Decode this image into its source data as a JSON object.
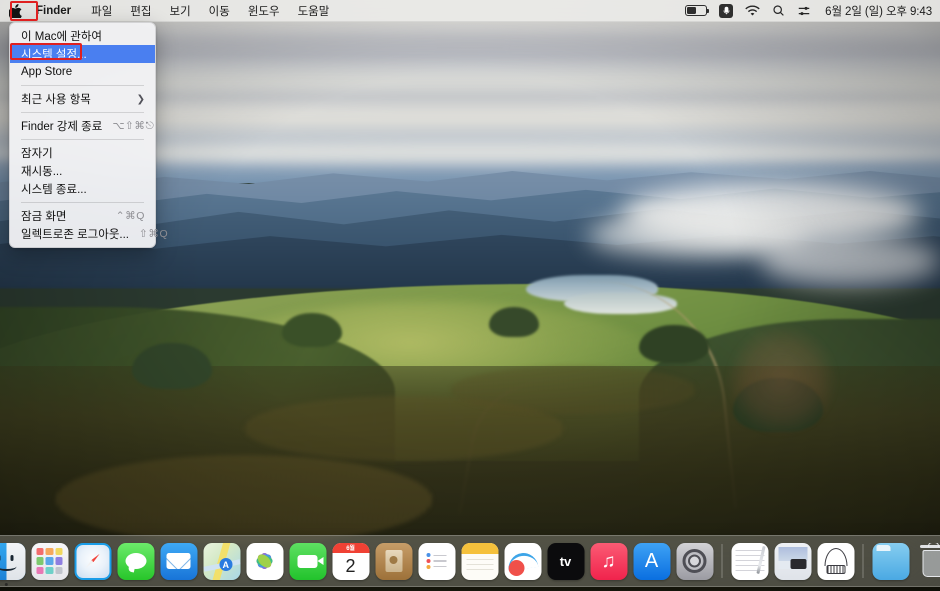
{
  "menubar": {
    "apple_icon": "apple-logo-icon",
    "app_name": "Finder",
    "items": [
      {
        "label": "파일"
      },
      {
        "label": "편집"
      },
      {
        "label": "보기"
      },
      {
        "label": "이동"
      },
      {
        "label": "윈도우"
      },
      {
        "label": "도움말"
      }
    ],
    "status_icons": [
      {
        "name": "battery-icon"
      },
      {
        "name": "screen-recording-icon"
      },
      {
        "name": "wifi-icon"
      },
      {
        "name": "spotlight-search-icon"
      },
      {
        "name": "control-center-icon"
      }
    ],
    "clock": "6월 2일 (일) 오후 9:43"
  },
  "apple_menu": {
    "selected_index": 1,
    "highlight_color": "#4a7ff0",
    "annotation_color": "#e02020",
    "items": [
      {
        "label": "이 Mac에 관하여",
        "shortcut": "",
        "arrow": ""
      },
      {
        "label": "시스템 설정...",
        "shortcut": "",
        "arrow": ""
      },
      {
        "label": "App Store",
        "shortcut": "",
        "arrow": ""
      },
      {
        "label": "최근 사용 항목",
        "shortcut": "",
        "arrow": "❯"
      },
      {
        "label": "Finder 강제 종료",
        "shortcut": "⌥⇧⌘⎋",
        "arrow": ""
      },
      {
        "label": "잠자기",
        "shortcut": "",
        "arrow": ""
      },
      {
        "label": "재시동...",
        "shortcut": "",
        "arrow": ""
      },
      {
        "label": "시스템 종료...",
        "shortcut": "",
        "arrow": ""
      },
      {
        "label": "잠금 화면",
        "shortcut": "⌃⌘Q",
        "arrow": ""
      },
      {
        "label": "일렉트로존 로그아웃...",
        "shortcut": "⇧⌘Q",
        "arrow": ""
      }
    ]
  },
  "dock": {
    "items": [
      {
        "name": "finder",
        "label": "Finder",
        "running": true
      },
      {
        "name": "launchpad",
        "label": "Launchpad",
        "running": false
      },
      {
        "name": "safari",
        "label": "Safari",
        "running": false
      },
      {
        "name": "messages",
        "label": "메시지",
        "running": false
      },
      {
        "name": "mail",
        "label": "Mail",
        "running": false
      },
      {
        "name": "maps",
        "label": "지도",
        "running": false
      },
      {
        "name": "photos",
        "label": "사진",
        "running": false
      },
      {
        "name": "facetime",
        "label": "FaceTime",
        "running": false
      },
      {
        "name": "calendar",
        "label": "캘린더",
        "running": false,
        "month": "6월",
        "day": "2"
      },
      {
        "name": "contacts",
        "label": "연락처",
        "running": false
      },
      {
        "name": "reminders",
        "label": "미리 알림",
        "running": false
      },
      {
        "name": "notes",
        "label": "메모",
        "running": false
      },
      {
        "name": "freeform",
        "label": "Freeform",
        "running": false
      },
      {
        "name": "apple-tv",
        "label": "Apple TV",
        "running": false,
        "glyph": "tv"
      },
      {
        "name": "music",
        "label": "음악",
        "running": false,
        "glyph": "♫"
      },
      {
        "name": "app-store",
        "label": "App Store",
        "running": false,
        "glyph": "A"
      },
      {
        "name": "system-settings",
        "label": "시스템 설정",
        "running": false
      },
      {
        "name": "separator-1",
        "label": "",
        "running": false
      },
      {
        "name": "textedit",
        "label": "텍스트 편집기",
        "running": false
      },
      {
        "name": "image-capture",
        "label": "이미지 캡처",
        "running": false
      },
      {
        "name": "airport-utility",
        "label": "AirPort 유틸리티",
        "running": false
      },
      {
        "name": "separator-2",
        "label": "",
        "running": false
      },
      {
        "name": "downloads",
        "label": "다운로드",
        "running": false
      },
      {
        "name": "trash",
        "label": "휴지통",
        "running": false
      }
    ]
  },
  "wallpaper": {
    "name": "Sonoma Hills",
    "sky_color": "#d8d9d6",
    "hill_color": "#7d9a4a",
    "foreground_color": "#302e16"
  }
}
